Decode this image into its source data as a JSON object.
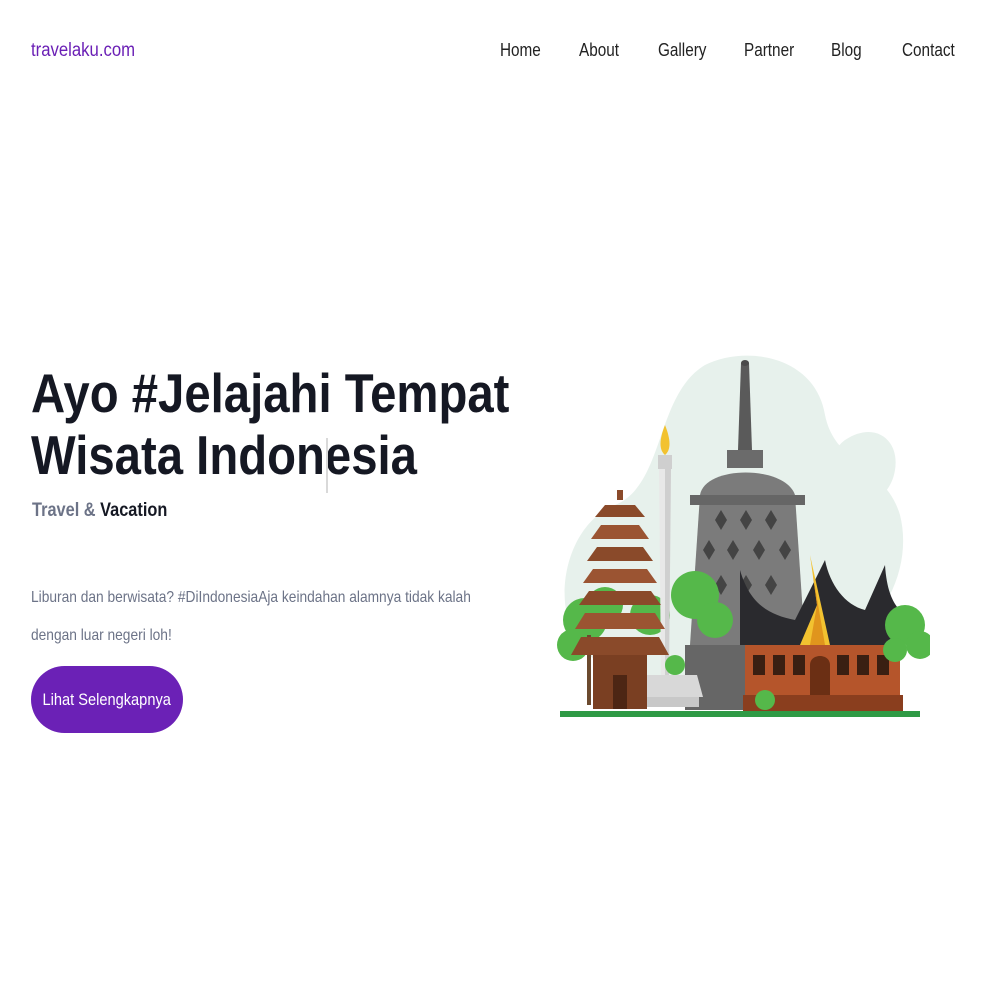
{
  "brand": "travelaku.com",
  "nav": [
    {
      "label": "Home"
    },
    {
      "label": "About"
    },
    {
      "label": "Gallery"
    },
    {
      "label": "Partner"
    },
    {
      "label": "Blog"
    },
    {
      "label": "Contact"
    }
  ],
  "hero": {
    "title_line1": "Ayo #Jelajahi Tempat",
    "title_line2": "Wisata Indonesia",
    "subtitle_part1": "Travel &",
    "subtitle_part2": "Vacation",
    "description": "Liburan dan berwisata? #DiIndonesiaAja keindahan alamnya tidak kalah dengan luar negeri loh!",
    "cta_label": "Lihat Selengkapnya"
  },
  "colors": {
    "brand": "#6a1fb5",
    "button": "#6b21b6",
    "heading": "#151823",
    "muted": "#6c7387"
  },
  "illustration": "indonesian-landmarks-illustration"
}
